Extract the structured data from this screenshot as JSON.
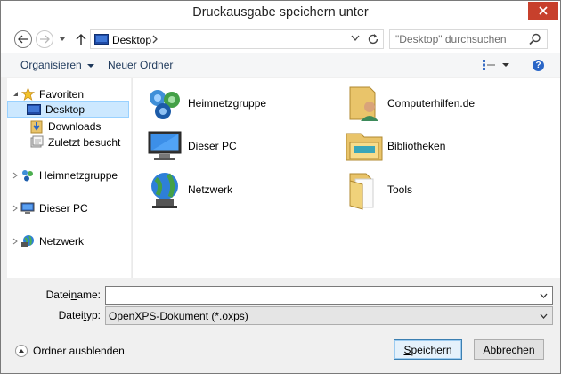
{
  "window": {
    "title": "Druckausgabe speichern unter"
  },
  "address": {
    "crumb": "Desktop"
  },
  "search": {
    "placeholder": "\"Desktop\" durchsuchen"
  },
  "toolbar": {
    "organize": "Organisieren",
    "new_folder": "Neuer Ordner"
  },
  "nav": {
    "favorites": "Favoriten",
    "items": [
      {
        "label": "Desktop",
        "icon": "desktop-icon",
        "selected": true
      },
      {
        "label": "Downloads",
        "icon": "downloads-icon"
      },
      {
        "label": "Zuletzt besucht",
        "icon": "recent-places-icon"
      }
    ],
    "homegroup": "Heimnetzgruppe",
    "this_pc": "Dieser PC",
    "network": "Netzwerk"
  },
  "content": {
    "items": [
      {
        "label": "Heimnetzgruppe",
        "icon": "homegroup-icon"
      },
      {
        "label": "Computerhilfen.de",
        "icon": "user-folder-icon"
      },
      {
        "label": "Dieser PC",
        "icon": "computer-icon"
      },
      {
        "label": "Bibliotheken",
        "icon": "libraries-icon"
      },
      {
        "label": "Netzwerk",
        "icon": "network-icon"
      },
      {
        "label": "Tools",
        "icon": "folder-icon"
      }
    ]
  },
  "form": {
    "filename_label_pre": "Datei",
    "filename_label_ul": "n",
    "filename_label_post": "ame:",
    "filename_value": "",
    "filetype_label_pre": "Datei",
    "filetype_label_ul": "t",
    "filetype_label_post": "yp:",
    "filetype_value": "OpenXPS-Dokument (*.oxps)"
  },
  "footer": {
    "hide_folders": "Ordner ausblenden",
    "save_ul": "S",
    "save_rest": "peichern",
    "cancel": "Abbrechen"
  },
  "colors": {
    "close": "#c7402c",
    "selection": "#cce8ff",
    "accent": "#3c7fb1"
  }
}
